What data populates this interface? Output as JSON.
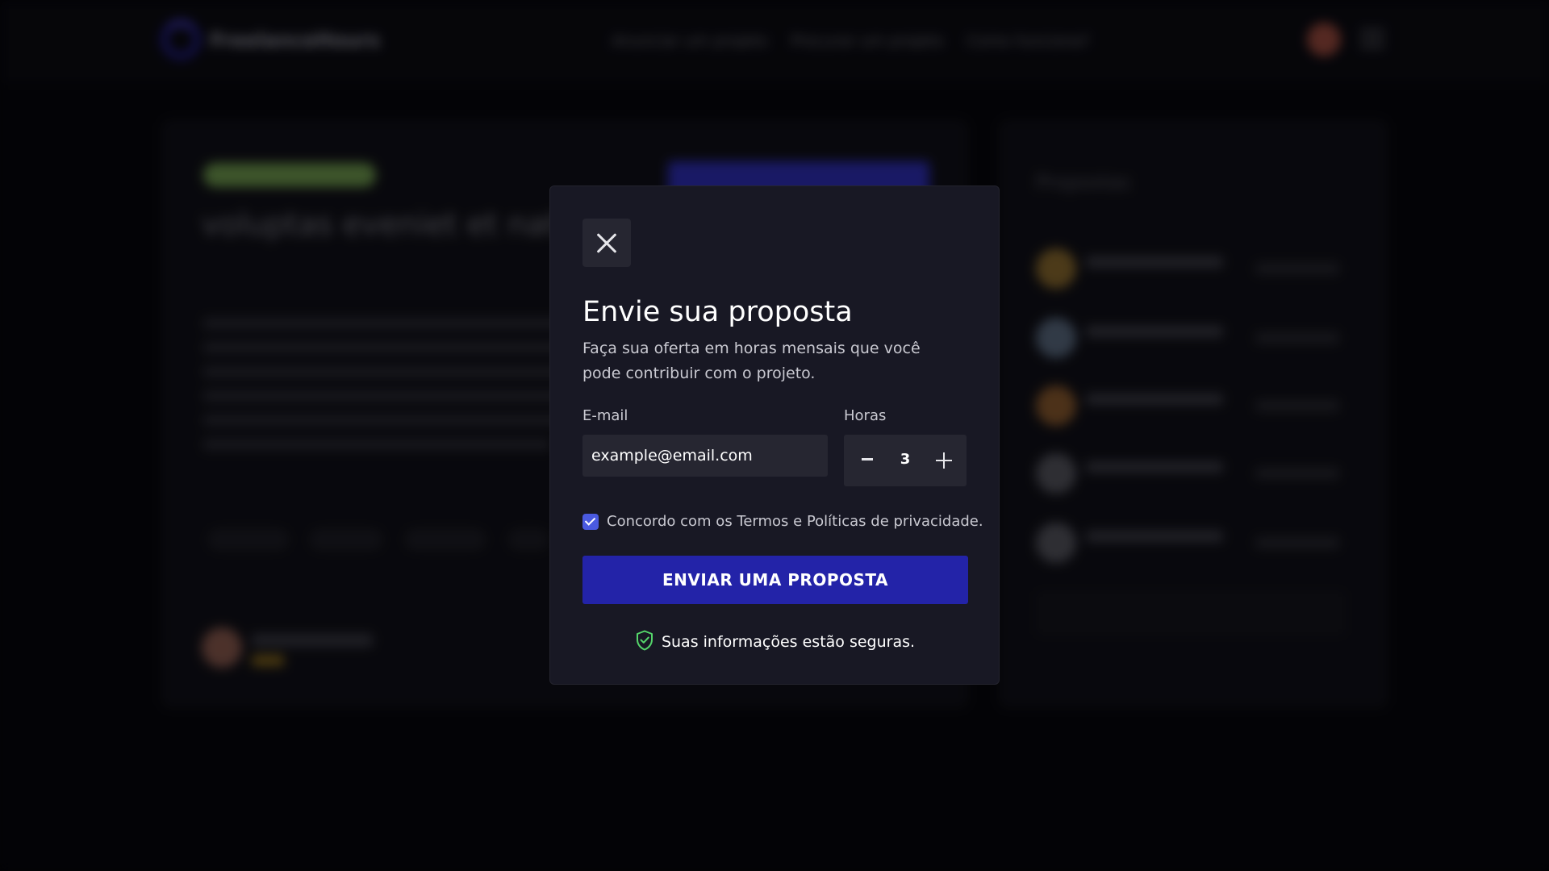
{
  "header": {
    "logo_text": "FreelanceHours",
    "nav": [
      "Anunciar um projeto",
      "Procurar um projeto",
      "Como funciona?"
    ]
  },
  "project": {
    "title": "voluptas eveniet et natus es"
  },
  "proposals_panel": {
    "title": "Propostas"
  },
  "modal": {
    "title": "Envie sua proposta",
    "description": "Faça sua oferta em horas mensais que você pode contribuir com o projeto.",
    "email_label": "E-mail",
    "email_value": "example@email.com",
    "hours_label": "Horas",
    "hours_value": "3",
    "terms_text": "Concordo com os Termos e Políticas de privacidade.",
    "terms_checked": true,
    "submit_label": "ENVIAR UMA PROPOSTA",
    "secure_text": "Suas informações estão seguras."
  },
  "colors": {
    "accent": "#2323a8",
    "checkbox": "#4a5ae0",
    "secure_icon": "#55d66b",
    "modal_bg": "#181824"
  },
  "icons": {
    "close": "close-icon",
    "shield": "shield-check-icon",
    "minus": "minus-icon",
    "plus": "plus-icon"
  }
}
